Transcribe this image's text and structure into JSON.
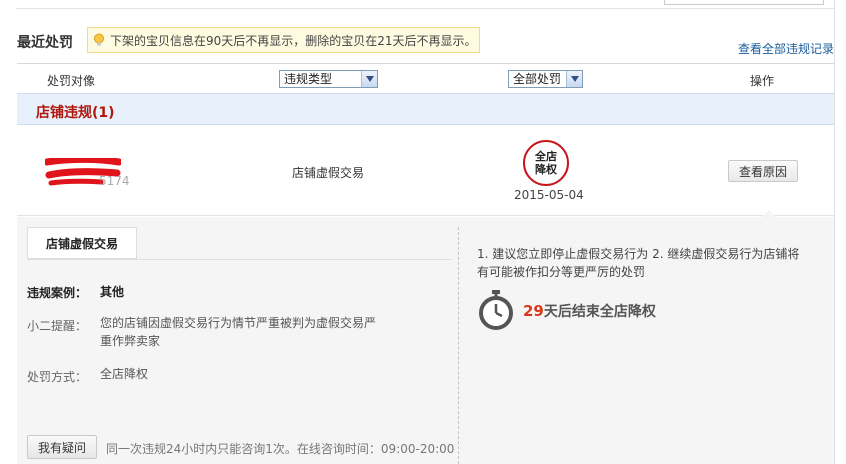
{
  "section": {
    "title": "最近处罚",
    "tip": "下架的宝贝信息在90天后不再显示，删除的宝贝在21天后不再显示。",
    "view_all": "查看全部违规记录"
  },
  "filters": {
    "object_header": "处罚对像",
    "type_select": "违规类型",
    "penalty_select": "全部处罚",
    "operation_header": "操作"
  },
  "group": {
    "title": "店铺违规(1)"
  },
  "row": {
    "shop_id_suffix": "5174",
    "violation_type": "店铺虚假交易",
    "penalty_stamp": "全店降权",
    "date": "2015-05-04",
    "reason_button": "查看原因"
  },
  "detail": {
    "tab": "店铺虚假交易",
    "case_label": "违规案例：",
    "case_value": "其他",
    "reminder_label": "小二提醒：",
    "reminder_value": "您的店铺因虚假交易行为情节严重被判为虚假交易严重作弊卖家",
    "method_label": "处罚方式：",
    "method_value": "全店降权",
    "ask_button": "我有疑问",
    "ask_note": "同一次违规24小时内只能咨询1次。在线咨询时间：09:00-20:00",
    "advice": "1. 建议您立即停止虚假交易行为 2. 继续虚假交易行为店铺将有可能被作扣分等更严厉的处罚",
    "countdown_days": "29",
    "countdown_text": "天后结束全店降权"
  },
  "colors": {
    "accent_red": "#b0170c",
    "link_blue": "#1a5b9c",
    "group_bg": "#e8f1fb",
    "detail_bg": "#f5f5f5"
  },
  "icons": [
    "lightbulb-icon",
    "chevron-down-icon",
    "stopwatch-icon"
  ]
}
